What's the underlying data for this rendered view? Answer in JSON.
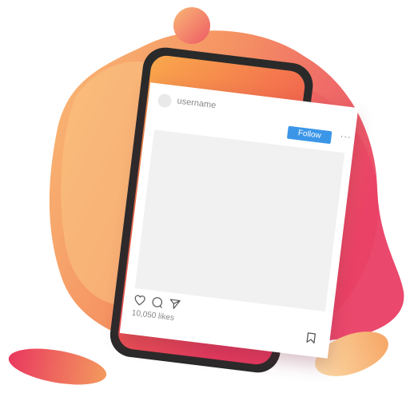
{
  "post": {
    "username": "username",
    "follow_label": "Follow",
    "more_label": "···",
    "likes_text": "10,050 likes"
  },
  "icons": {
    "like": "heart-icon",
    "comment": "comment-icon",
    "share": "paper-plane-icon",
    "save": "bookmark-icon",
    "more": "more-dots-icon"
  },
  "colors": {
    "follow_button": "#3b96e8",
    "blob_pink": "#ea3f66",
    "blob_orange": "#f7a24c",
    "phone_frame": "#2b2b2b"
  }
}
